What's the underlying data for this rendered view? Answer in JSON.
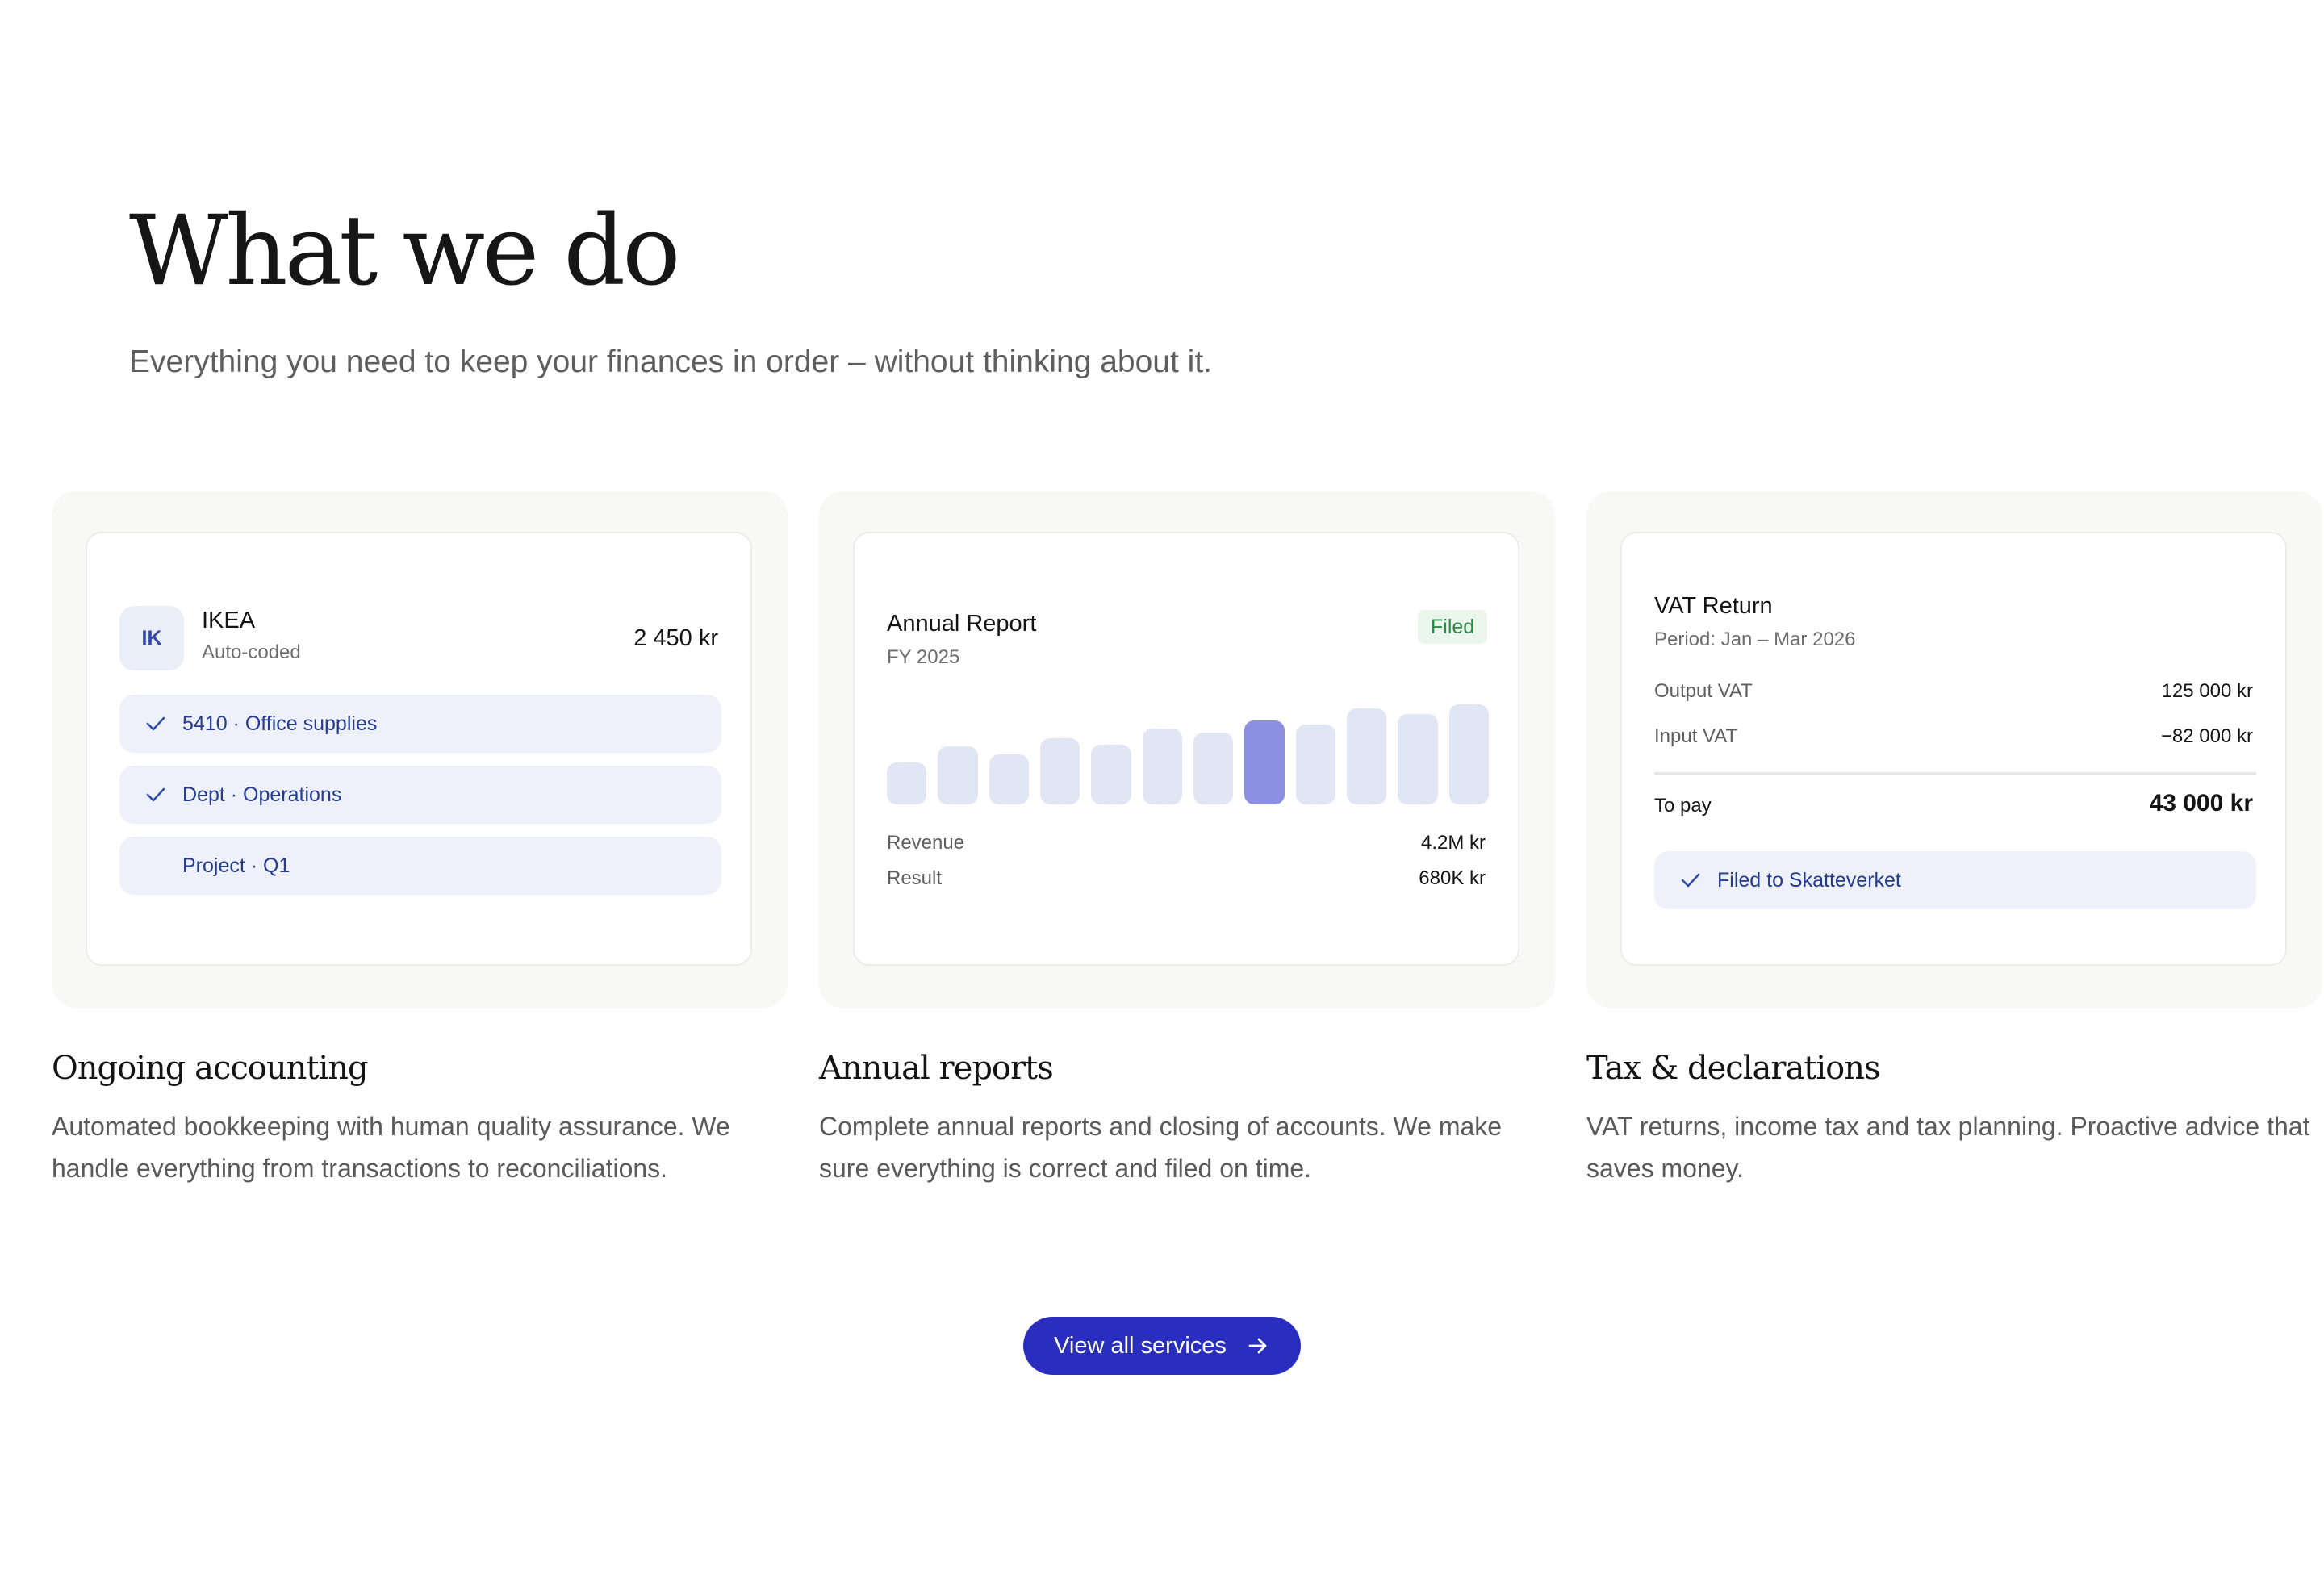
{
  "hero": {
    "title": "What we do",
    "subtitle": "Everything you need to keep your finances in order – without thinking about it."
  },
  "cards": [
    {
      "mock": {
        "avatar": "IK",
        "vendor": "IKEA",
        "status": "Auto-coded",
        "amount": "2 450 kr",
        "tags": [
          {
            "label": "5410 · Office supplies",
            "checked": true
          },
          {
            "label": "Dept · Operations",
            "checked": true
          },
          {
            "label": "Project · Q1",
            "checked": false
          }
        ]
      },
      "title": "Ongoing accounting",
      "description": "Automated bookkeeping with human quality assurance. We handle everything from transactions to reconciliations."
    },
    {
      "mock": {
        "title": "Annual Report",
        "subtitle": "FY 2025",
        "badge": "Filed",
        "bars": [
          0.42,
          0.58,
          0.5,
          0.66,
          0.6,
          0.76,
          0.72,
          0.84,
          0.8,
          0.96,
          0.9,
          1.0
        ],
        "highlight_index": 7,
        "rows": [
          {
            "label": "Revenue",
            "value": "4.2M kr"
          },
          {
            "label": "Result",
            "value": "680K kr"
          }
        ]
      },
      "title": "Annual reports",
      "description": "Complete annual reports and closing of accounts. We make sure everything is correct and filed on time."
    },
    {
      "mock": {
        "title": "VAT Return",
        "period": "Period: Jan – Mar 2026",
        "rows": [
          {
            "label": "Output VAT",
            "value": "125 000 kr"
          },
          {
            "label": "Input VAT",
            "value": "−82 000 kr"
          }
        ],
        "total_label": "To pay",
        "total_value": "43 000 kr",
        "status": "Filed to Skatteverket"
      },
      "title": "Tax & declarations",
      "description": "VAT returns, income tax and tax planning. Proactive advice that saves money."
    }
  ],
  "cta": {
    "label": "View all services",
    "icon": "arrow-right-icon"
  },
  "colors": {
    "accent": "#2a2ebf",
    "bar": "#e0e6f3",
    "bar_highlight": "#8d90e2",
    "pill": "#eef1fa",
    "badge_green": "#2c8a47"
  }
}
